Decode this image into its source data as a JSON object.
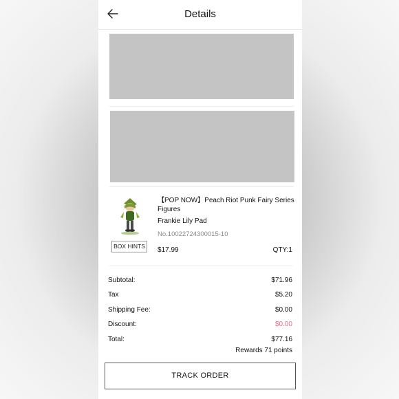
{
  "header": {
    "title": "Details",
    "back_icon": "arrow-left-icon"
  },
  "product": {
    "name": "【POP NOW】Peach Riot Punk Fairy Series Figures",
    "character": "Frankie Lily Pad",
    "order_no": "No.10022724300015-10",
    "price": "$17.99",
    "qty": "QTY:1",
    "hints_label": "BOX HINTS"
  },
  "summary": {
    "subtotal_label": "Subtotal:",
    "subtotal_value": "$71.96",
    "tax_label": "Tax",
    "tax_value": "$5.20",
    "shipping_label": "Shipping Fee:",
    "shipping_value": "$0.00",
    "discount_label": "Discount:",
    "discount_value": "$0.00",
    "total_label": "Total:",
    "total_value": "$77.16",
    "rewards": "Rewards 71 points"
  },
  "colors": {
    "discount": "#e06b86",
    "placeholder": "#c4c4c4"
  },
  "actions": {
    "track_order": "TRACK ORDER"
  }
}
